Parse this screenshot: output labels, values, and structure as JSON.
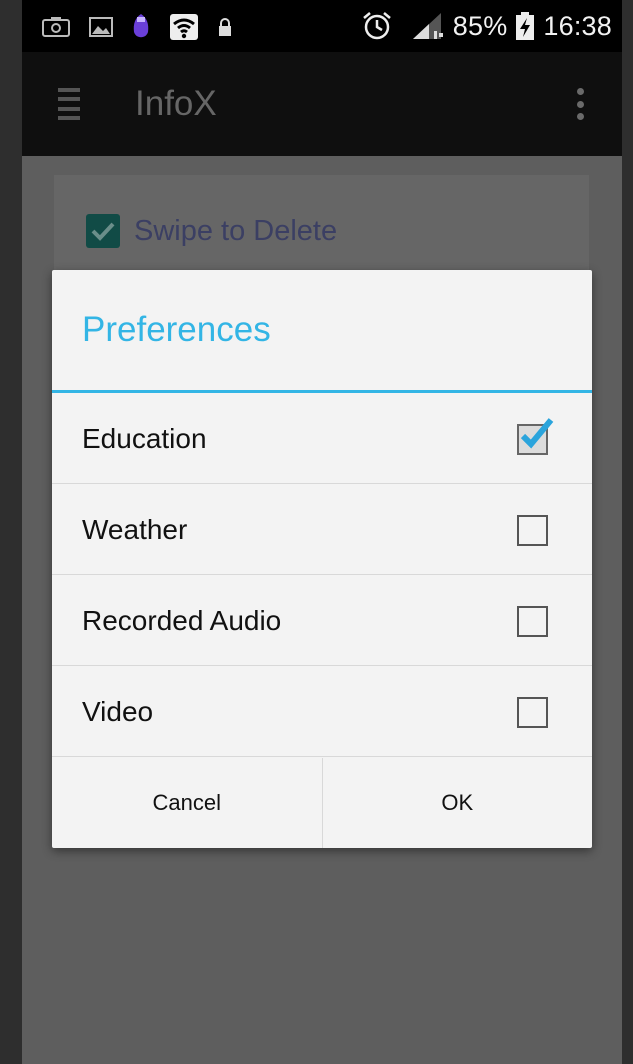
{
  "status_bar": {
    "icons_left": [
      "screenshot-icon",
      "gallery-icon",
      "app-notification-icon",
      "wifi-icon",
      "lock-icon"
    ],
    "icons_right": [
      "alarm-icon",
      "signal-icon",
      "battery-charging-icon"
    ],
    "battery": "85%",
    "time": "16:38"
  },
  "action_bar": {
    "title": "InfoX",
    "menu_icon": "hamburger-menu-icon",
    "overflow_icon": "overflow-menu-icon"
  },
  "background": {
    "swipe_label": "Swipe to Delete",
    "swipe_checked": true
  },
  "dialog": {
    "title": "Preferences",
    "items": [
      {
        "label": "Education",
        "checked": true
      },
      {
        "label": "Weather",
        "checked": false
      },
      {
        "label": "Recorded Audio",
        "checked": false
      },
      {
        "label": "Video",
        "checked": false
      }
    ],
    "cancel_label": "Cancel",
    "ok_label": "OK"
  },
  "colors": {
    "accent": "#33b5e5",
    "dim_overlay": "#5e5e5e",
    "dialog_bg": "#f3f3f3"
  }
}
